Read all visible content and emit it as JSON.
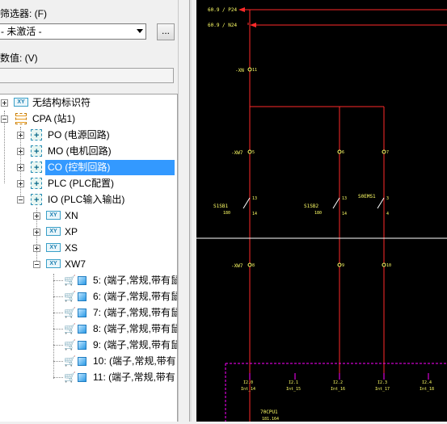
{
  "panel": {
    "filter_label": "筛选器: (F)",
    "filter_value": "- 未激活 -",
    "more_button": "...",
    "value_label": "数值: (V)",
    "value_text": ""
  },
  "tree": {
    "root": {
      "label": "无结构标识符",
      "icon": "xy-icon"
    },
    "cpa": {
      "label": "CPA (站1)",
      "icon": "list-icon"
    },
    "groups": [
      {
        "label": "PO (电源回路)",
        "icon": "function-icon"
      },
      {
        "label": "MO (电机回路)",
        "icon": "function-icon"
      },
      {
        "label": "CO (控制回路)",
        "icon": "function-icon",
        "selected": true
      },
      {
        "label": "PLC (PLC配置)",
        "icon": "function-icon"
      },
      {
        "label": "IO (PLC输入输出)",
        "icon": "function-icon"
      }
    ],
    "io_children": [
      {
        "label": "XN",
        "icon": "xy-icon"
      },
      {
        "label": "XP",
        "icon": "xy-icon"
      },
      {
        "label": "XS",
        "icon": "xy-icon"
      },
      {
        "label": "XW7",
        "icon": "xy-icon"
      }
    ],
    "terminals": [
      {
        "label": "5: (端子,常规,带有鼠"
      },
      {
        "label": "6: (端子,常规,带有鼠"
      },
      {
        "label": "7: (端子,常规,带有鼠"
      },
      {
        "label": "8: (端子,常规,带有鼠"
      },
      {
        "label": "9: (端子,常规,带有鼠"
      },
      {
        "label": "10: (端子,常规,带有"
      },
      {
        "label": "11: (端子,常规,带有"
      }
    ]
  },
  "schematic": {
    "background": "#000000",
    "wire_color": "#ff2a2a",
    "label_color": "#ffff66",
    "plc_color": "#ff00ff",
    "cursor_color": "#ffffff",
    "rail_labels": [
      "60.9 / P24",
      "60.9 / N24"
    ],
    "xn_label": "-XN",
    "xn_terminal": "11",
    "xw7_label_top": "-XW7",
    "xw7_label_bottom": "-XW7",
    "terminals_top": [
      "5",
      "6",
      "7"
    ],
    "terminals_bottom": [
      "8",
      "9",
      "10"
    ],
    "switches": [
      {
        "name": "S1SB1",
        "sub": "180",
        "pin_top": "13",
        "pin_bottom": "14"
      },
      {
        "name": "S1SB2",
        "sub": "180",
        "pin_top": "13",
        "pin_bottom": "14"
      },
      {
        "name": "S0EMS1",
        "sub": "",
        "pin_top": "3",
        "pin_bottom": "4"
      }
    ],
    "plc_inputs": [
      {
        "addr": "I2.0",
        "name": "Int_14"
      },
      {
        "addr": "I2.1",
        "name": "Int_15"
      },
      {
        "addr": "I2.2",
        "name": "Int_16"
      },
      {
        "addr": "I2.3",
        "name": "Int_17"
      },
      {
        "addr": "I2.4",
        "name": "Int_18"
      }
    ],
    "plc_name": "70CPU1",
    "plc_sub": "181.164"
  }
}
